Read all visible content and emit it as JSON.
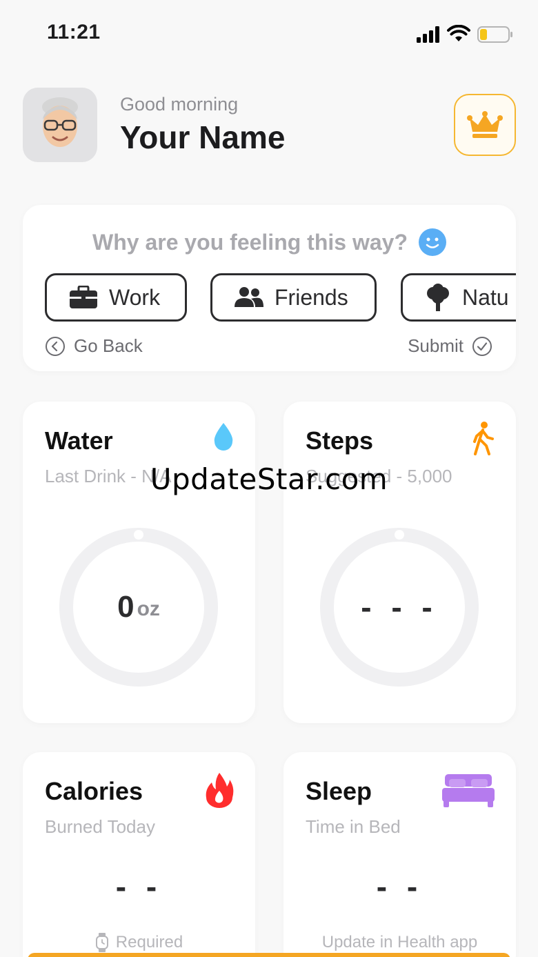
{
  "status_bar": {
    "time": "11:21",
    "battery_color": "#f5c518"
  },
  "header": {
    "greeting": "Good morning",
    "user_name": "Your Name",
    "premium_icon": "crown-icon",
    "accent_color": "#f5a623"
  },
  "feeling": {
    "question": "Why are you feeling this way?",
    "question_icon": "smile-icon",
    "chips": [
      {
        "label": "Work",
        "icon": "briefcase-icon"
      },
      {
        "label": "Friends",
        "icon": "friends-icon"
      },
      {
        "label": "Natu",
        "icon": "tree-icon"
      }
    ],
    "go_back_label": "Go Back",
    "submit_label": "Submit"
  },
  "metrics": {
    "water": {
      "title": "Water",
      "subtitle": "Last Drink - N/A",
      "value": "0",
      "unit": "oz",
      "icon": "water-drop-icon",
      "icon_color": "#5ac8fa"
    },
    "steps": {
      "title": "Steps",
      "subtitle": "Suggested - 5,000",
      "value": "- - -",
      "icon": "walking-icon",
      "icon_color": "#ff9500"
    },
    "calories": {
      "title": "Calories",
      "subtitle": "Burned Today",
      "value": "- -",
      "footnote": "Required",
      "icon": "flame-icon",
      "icon_color": "#ff2d2d"
    },
    "sleep": {
      "title": "Sleep",
      "subtitle": "Time in Bed",
      "value": "- -",
      "footnote": "Update in Health app",
      "icon": "bed-icon",
      "icon_color": "#b57bee"
    }
  },
  "watermark": "UpdateStar.com"
}
